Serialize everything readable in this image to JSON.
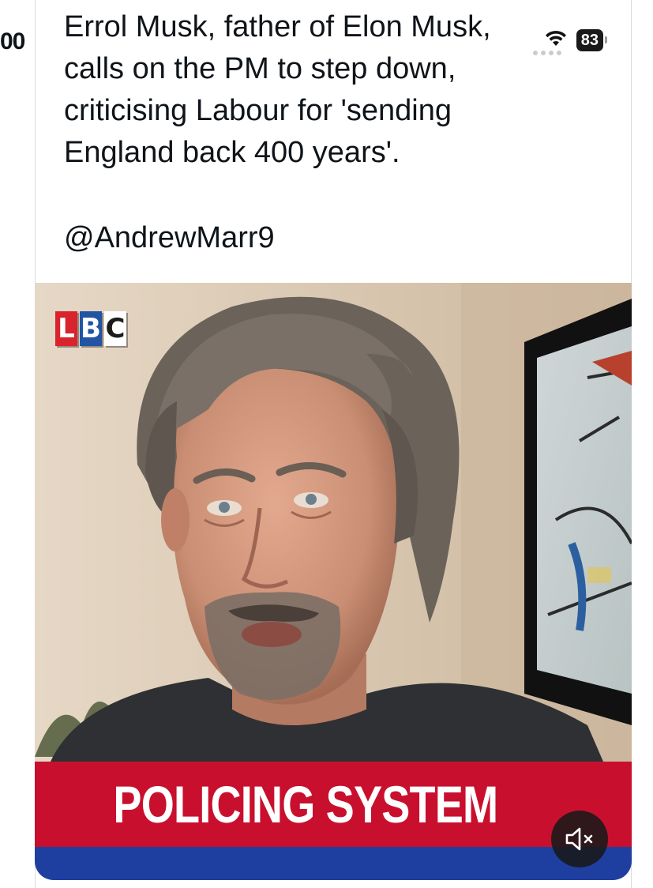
{
  "left_partial": "00",
  "status_bar": {
    "battery": "83",
    "wifi_icon": "wifi-icon"
  },
  "tweet": {
    "text": "Errol Musk, father of Elon Musk, calls on the PM to step down, criticising Labour for 'sending England back 400 years'.",
    "handle": "@AndrewMarr9"
  },
  "media": {
    "channel_logo": "LBC",
    "lower_third": "POLICING SYSTEM",
    "mute_icon": "speaker-muted-icon"
  },
  "colors": {
    "lbc_red": "#d9232d",
    "lbc_blue": "#2154a4",
    "banner_red": "#c8102e",
    "banner_blue": "#1f3fa0"
  }
}
